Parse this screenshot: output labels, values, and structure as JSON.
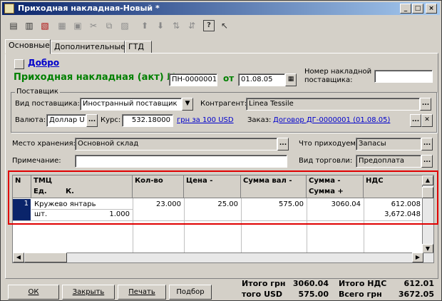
{
  "window": {
    "title": "Приходная накладная-Новый *",
    "min": "_",
    "max": "□",
    "close": "×"
  },
  "toolbar": {
    "icons": [
      "new-doc-icon",
      "copy-doc-icon",
      "delete-doc-icon",
      "print-icon",
      "preview-icon",
      "cut-icon",
      "copy-icon",
      "paste-icon",
      "move-up-icon",
      "move-down-icon",
      "sort-asc-icon",
      "sort-desc-icon",
      "help-icon",
      "context-help-icon"
    ]
  },
  "tabs": [
    {
      "label": "Основные"
    },
    {
      "label": "Дополнительные"
    },
    {
      "label": "ГТД"
    }
  ],
  "header": {
    "dobro_link": "Добро",
    "doc_title": "Приходная накладная (акт) №",
    "doc_number": "ПН-0000001",
    "from_label": "от",
    "doc_date": "01.08.05",
    "nomer_label_1": "Номер накладной",
    "nomer_label_2": "поставщика:",
    "nomer_value": ""
  },
  "supplier": {
    "group_label": "Поставщик",
    "vid_label": "Вид поставщика:",
    "vid_value": "Иностранный поставщик",
    "kontragent_label": "Контрагент:",
    "kontragent_value": "Linea Tessile",
    "currency_label": "Валюта:",
    "currency_value": "Доллар U",
    "rate_label": "Курс:",
    "rate_value": "532.18000",
    "rate_link": "грн за 100 USD",
    "order_label": "Заказ:",
    "order_link": "Договор ДГ-0000001 (01.08.05)"
  },
  "storage": {
    "label": "Место хранения:",
    "value": "Основной склад"
  },
  "what": {
    "label": "Что приходуем:",
    "value": "Запасы"
  },
  "note": {
    "label": "Примечание:",
    "value": ""
  },
  "trade": {
    "label": "Вид торговли:",
    "value": "Предоплата"
  },
  "grid": {
    "headers": {
      "n": "N",
      "tmc": "ТМЦ",
      "ed": "Ед.",
      "k": "К.",
      "qty": "Кол-во",
      "price": "Цена -",
      "sum_val": "Сумма вал -",
      "sum": "Сумма -",
      "sum_plus": "Сумма +",
      "nds": "НДС"
    },
    "rows": [
      {
        "n": "1",
        "name": "Кружево янтарь",
        "unit": "шт.",
        "k": "1.000",
        "qty": "23.000",
        "price": "25.00",
        "sum_val": "575.00",
        "sum": "3060.04",
        "nds": "612.008",
        "sum_plus": "3,672.048"
      }
    ]
  },
  "buttons": {
    "ok": "ОК",
    "close": "Закрыть",
    "print": "Печать",
    "select": "Подбор"
  },
  "totals": {
    "itogo_grn_label": "Итого грн",
    "itogo_grn": "3060.04",
    "itogo_nds_label": "Итого НДС",
    "itogo_nds": "612.01",
    "itogo_usd_label": "того USD",
    "itogo_usd": "575.00",
    "vsego_grn_label": "Всего грн",
    "vsego_grn": "3672.05"
  }
}
